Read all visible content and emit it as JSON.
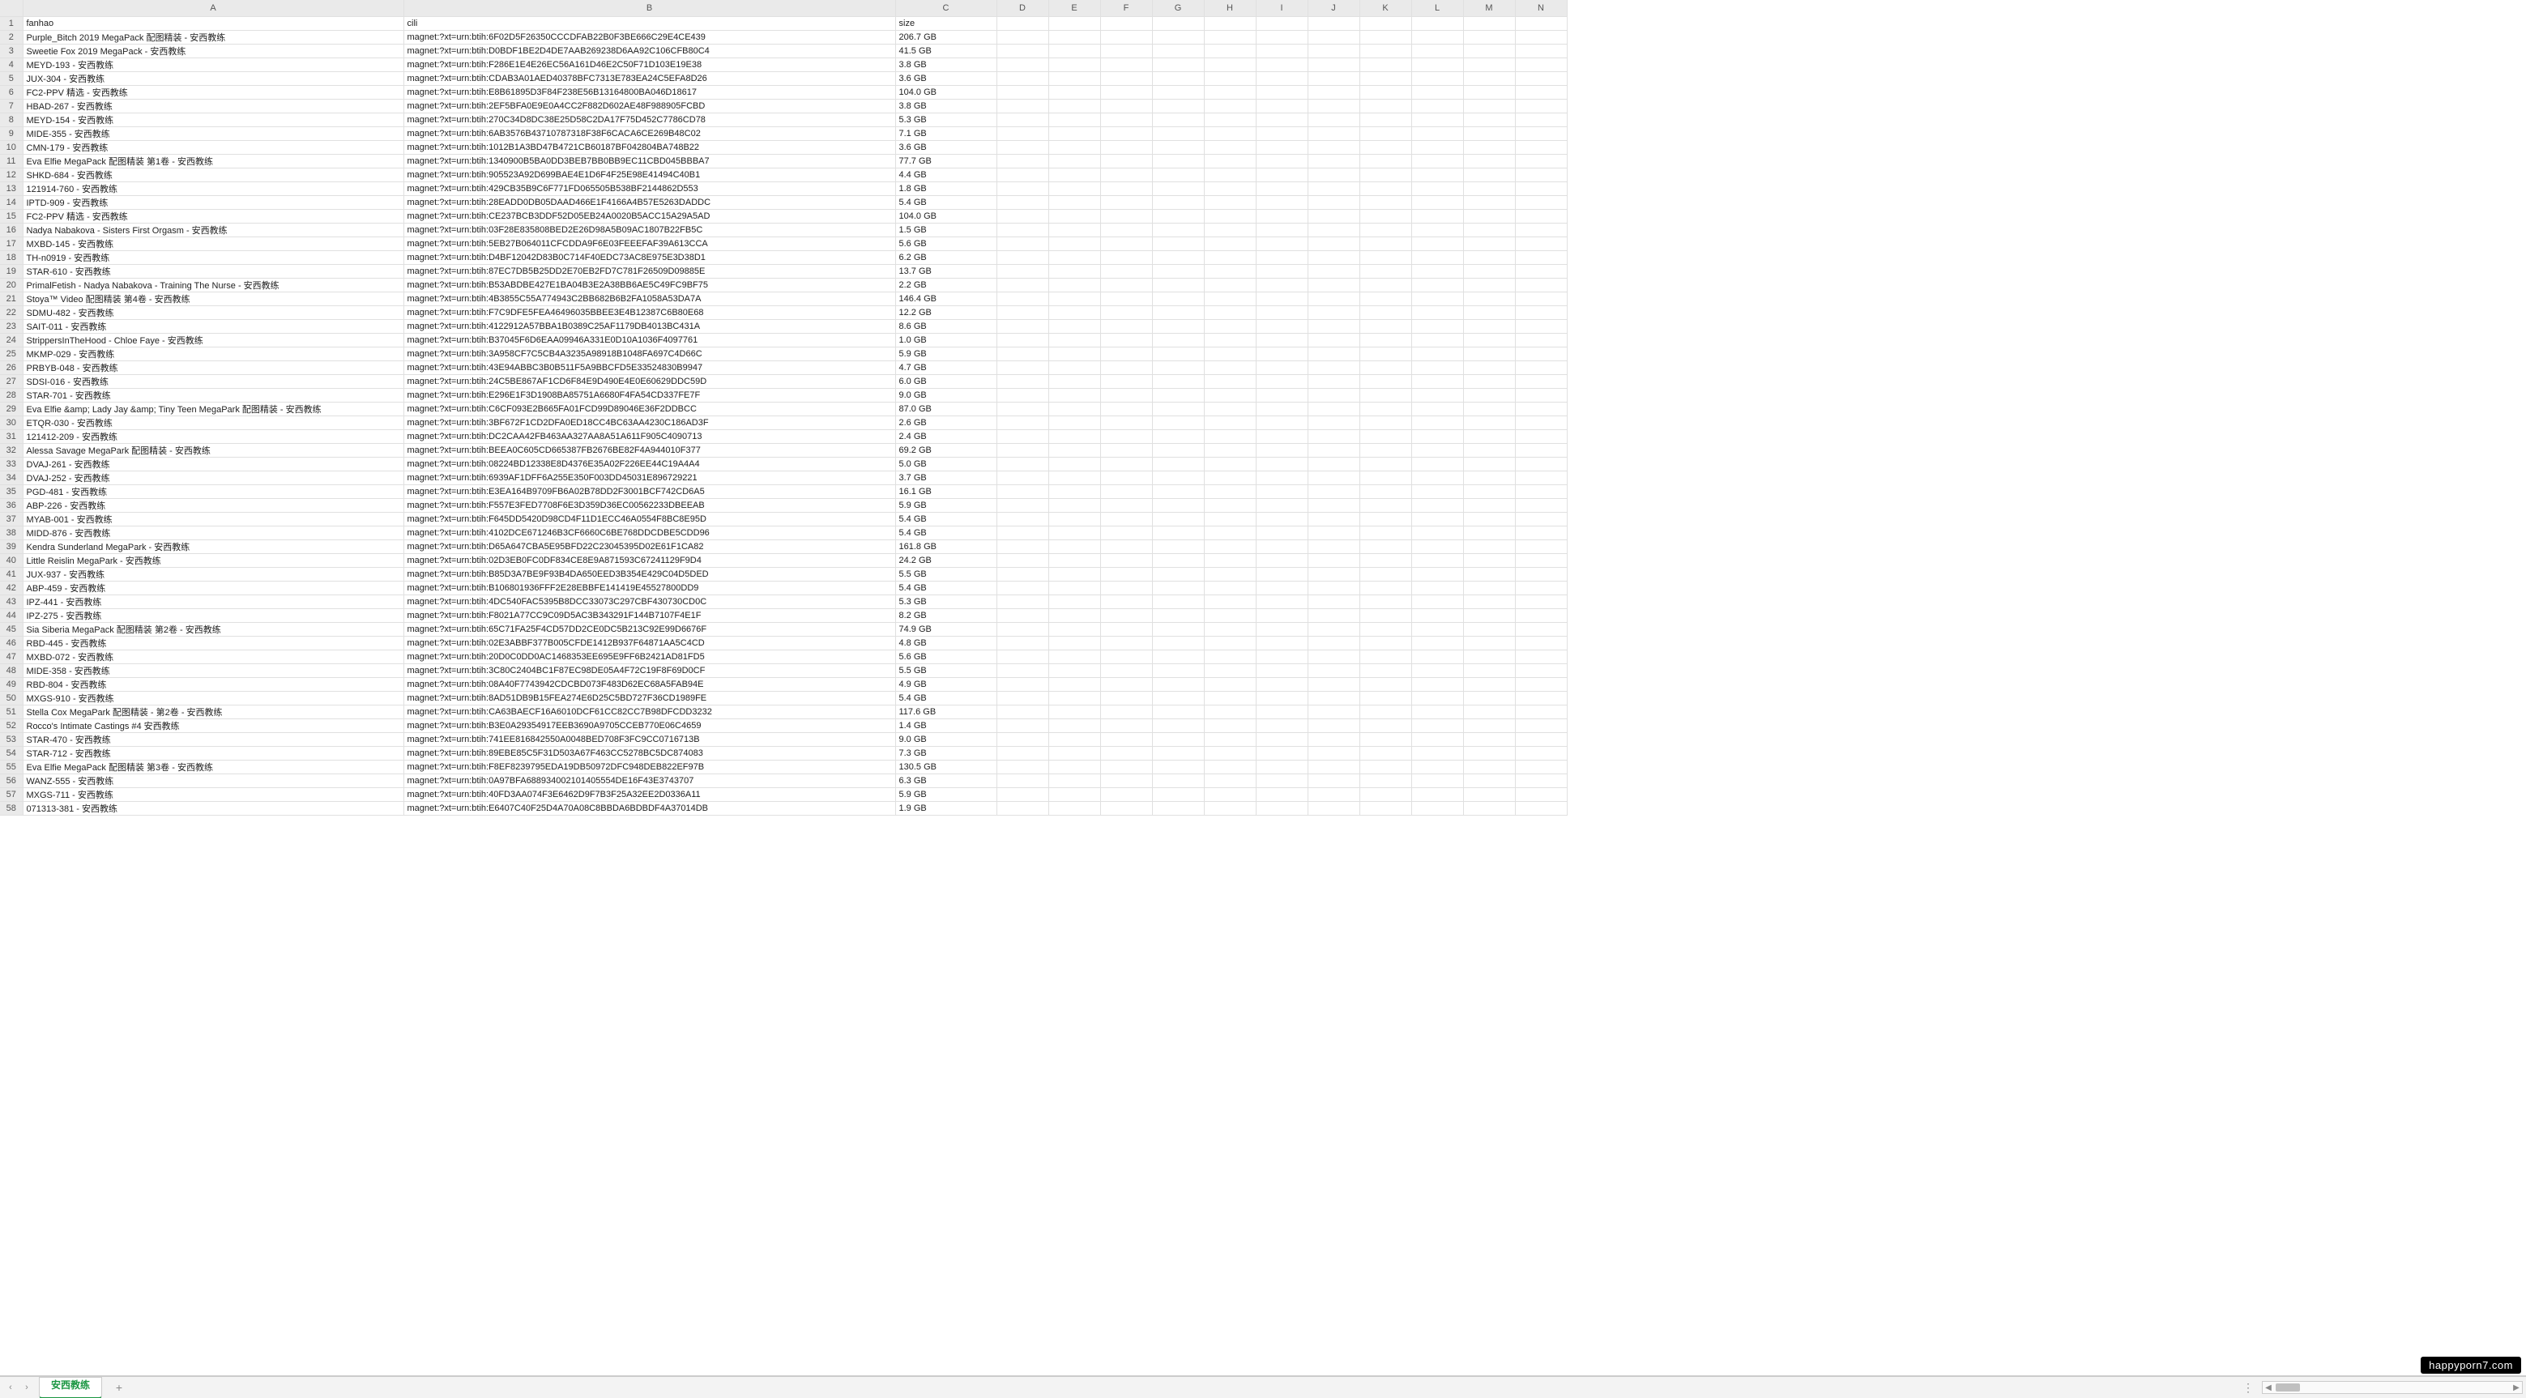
{
  "columns": [
    "A",
    "B",
    "C",
    "D",
    "E",
    "F",
    "G",
    "H",
    "I",
    "J",
    "K",
    "L",
    "M",
    "N"
  ],
  "headers": {
    "A": "fanhao",
    "B": "cili",
    "C": "size"
  },
  "rows": [
    {
      "n": "1",
      "A": "fanhao",
      "B": "cili",
      "C": "size"
    },
    {
      "n": "2",
      "A": "Purple_Bitch 2019 MegaPack 配图精装 - 安西教练",
      "B": "magnet:?xt=urn:btih:6F02D5F26350CCCDFAB22B0F3BE666C29E4CE439",
      "C": "206.7 GB"
    },
    {
      "n": "3",
      "A": "Sweetie Fox 2019 MegaPack - 安西教练",
      "B": "magnet:?xt=urn:btih:D0BDF1BE2D4DE7AAB269238D6AA92C106CFB80C4",
      "C": "41.5 GB"
    },
    {
      "n": "4",
      "A": "MEYD-193 - 安西教练",
      "B": "magnet:?xt=urn:btih:F286E1E4E26EC56A161D46E2C50F71D103E19E38",
      "C": "3.8 GB"
    },
    {
      "n": "5",
      "A": "JUX-304 - 安西教练",
      "B": "magnet:?xt=urn:btih:CDAB3A01AED40378BFC7313E783EA24C5EFA8D26",
      "C": "3.6 GB"
    },
    {
      "n": "6",
      "A": "FC2-PPV 精选 - 安西教练",
      "B": "magnet:?xt=urn:btih:E8B61895D3F84F238E56B13164800BA046D18617",
      "C": "104.0 GB"
    },
    {
      "n": "7",
      "A": "HBAD-267 - 安西教练",
      "B": "magnet:?xt=urn:btih:2EF5BFA0E9E0A4CC2F882D602AE48F988905FCBD",
      "C": "3.8 GB"
    },
    {
      "n": "8",
      "A": "MEYD-154 - 安西教练",
      "B": "magnet:?xt=urn:btih:270C34D8DC38E25D58C2DA17F75D452C7786CD78",
      "C": "5.3 GB"
    },
    {
      "n": "9",
      "A": "MIDE-355 - 安西教练",
      "B": "magnet:?xt=urn:btih:6AB3576B43710787318F38F6CACA6CE269B48C02",
      "C": "7.1 GB"
    },
    {
      "n": "10",
      "A": "CMN-179 - 安西教练",
      "B": "magnet:?xt=urn:btih:1012B1A3BD47B4721CB60187BF042804BA748B22",
      "C": "3.6 GB"
    },
    {
      "n": "11",
      "A": "Eva Elfie MegaPack 配图精装 第1卷 - 安西教练",
      "B": "magnet:?xt=urn:btih:1340900B5BA0DD3BEB7BB0BB9EC11CBD045BBBA7",
      "C": "77.7 GB"
    },
    {
      "n": "12",
      "A": "SHKD-684 - 安西教练",
      "B": "magnet:?xt=urn:btih:905523A92D699BAE4E1D6F4F25E98E41494C40B1",
      "C": "4.4 GB"
    },
    {
      "n": "13",
      "A": "121914-760 - 安西教练",
      "B": "magnet:?xt=urn:btih:429CB35B9C6F771FD065505B538BF2144862D553",
      "C": "1.8 GB"
    },
    {
      "n": "14",
      "A": "IPTD-909 - 安西教练",
      "B": "magnet:?xt=urn:btih:28EADD0DB05DAAD466E1F4166A4B57E5263DADDC",
      "C": "5.4 GB"
    },
    {
      "n": "15",
      "A": "FC2-PPV 精选 - 安西教练",
      "B": "magnet:?xt=urn:btih:CE237BCB3DDF52D05EB24A0020B5ACC15A29A5AD",
      "C": "104.0 GB"
    },
    {
      "n": "16",
      "A": "Nadya Nabakova - Sisters First Orgasm - 安西教练",
      "B": "magnet:?xt=urn:btih:03F28E835808BED2E26D98A5B09AC1807B22FB5C",
      "C": "1.5 GB"
    },
    {
      "n": "17",
      "A": "MXBD-145 - 安西教练",
      "B": "magnet:?xt=urn:btih:5EB27B064011CFCDDA9F6E03FEEEFAF39A613CCA",
      "C": "5.6 GB"
    },
    {
      "n": "18",
      "A": "TH-n0919 - 安西教练",
      "B": "magnet:?xt=urn:btih:D4BF12042D83B0C714F40EDC73AC8E975E3D38D1",
      "C": "6.2 GB"
    },
    {
      "n": "19",
      "A": "STAR-610 - 安西教练",
      "B": "magnet:?xt=urn:btih:87EC7DB5B25DD2E70EB2FD7C781F26509D09885E",
      "C": "13.7 GB"
    },
    {
      "n": "20",
      "A": "PrimalFetish - Nadya Nabakova - Training The Nurse - 安西教练",
      "B": "magnet:?xt=urn:btih:B53ABDBE427E1BA04B3E2A38BB6AE5C49FC9BF75",
      "C": "2.2 GB"
    },
    {
      "n": "21",
      "A": "Stoya™ Video 配图精装 第4卷 - 安西教练",
      "B": "magnet:?xt=urn:btih:4B3855C55A774943C2BB682B6B2FA1058A53DA7A",
      "C": "146.4 GB"
    },
    {
      "n": "22",
      "A": "SDMU-482 - 安西教练",
      "B": "magnet:?xt=urn:btih:F7C9DFE5FEA46496035BBEE3E4B12387C6B80E68",
      "C": "12.2 GB"
    },
    {
      "n": "23",
      "A": "SAIT-011 - 安西教练",
      "B": "magnet:?xt=urn:btih:4122912A57BBA1B0389C25AF1179DB4013BC431A",
      "C": "8.6 GB"
    },
    {
      "n": "24",
      "A": "StrippersInTheHood - Chloe Faye - 安西教练",
      "B": "magnet:?xt=urn:btih:B37045F6D6EAA09946A331E0D10A1036F4097761",
      "C": "1.0 GB"
    },
    {
      "n": "25",
      "A": "MKMP-029 - 安西教练",
      "B": "magnet:?xt=urn:btih:3A958CF7C5CB4A3235A98918B1048FA697C4D66C",
      "C": "5.9 GB"
    },
    {
      "n": "26",
      "A": "PRBYB-048 - 安西教练",
      "B": "magnet:?xt=urn:btih:43E94ABBC3B0B511F5A9BBCFD5E33524830B9947",
      "C": "4.7 GB"
    },
    {
      "n": "27",
      "A": "SDSI-016 - 安西教练",
      "B": "magnet:?xt=urn:btih:24C5BE867AF1CD6F84E9D490E4E0E60629DDC59D",
      "C": "6.0 GB"
    },
    {
      "n": "28",
      "A": "STAR-701 - 安西教练",
      "B": "magnet:?xt=urn:btih:E296E1F3D1908BA85751A6680F4FA54CD337FE7F",
      "C": "9.0 GB"
    },
    {
      "n": "29",
      "A": "Eva Elfie &amp; Lady Jay &amp; Tiny Teen MegaPark 配图精装 - 安西教练",
      "B": "magnet:?xt=urn:btih:C6CF093E2B665FA01FCD99D89046E36F2DDBCC",
      "C": "87.0 GB"
    },
    {
      "n": "30",
      "A": "ETQR-030 - 安西教练",
      "B": "magnet:?xt=urn:btih:3BF672F1CD2DFA0ED18CC4BC63AA4230C186AD3F",
      "C": "2.6 GB"
    },
    {
      "n": "31",
      "A": "121412-209 - 安西教练",
      "B": "magnet:?xt=urn:btih:DC2CAA42FB463AA327AA8A51A611F905C4090713",
      "C": "2.4 GB"
    },
    {
      "n": "32",
      "A": "Alessa Savage MegaPark 配图精装 - 安西教练",
      "B": "magnet:?xt=urn:btih:BEEA0C605CD665387FB2676BE82F4A944010F377",
      "C": "69.2 GB"
    },
    {
      "n": "33",
      "A": "DVAJ-261 - 安西教练",
      "B": "magnet:?xt=urn:btih:08224BD12338E8D4376E35A02F226EE44C19A4A4",
      "C": "5.0 GB"
    },
    {
      "n": "34",
      "A": "DVAJ-252 - 安西教练",
      "B": "magnet:?xt=urn:btih:6939AF1DFF6A255E350F003DD45031E896729221",
      "C": "3.7 GB"
    },
    {
      "n": "35",
      "A": "PGD-481 - 安西教练",
      "B": "magnet:?xt=urn:btih:E3EA164B9709FB6A02B78DD2F3001BCF742CD6A5",
      "C": "16.1 GB"
    },
    {
      "n": "36",
      "A": "ABP-226 - 安西教练",
      "B": "magnet:?xt=urn:btih:F557E3FED7708F6E3D359D36EC00562233DBEEAB",
      "C": "5.9 GB"
    },
    {
      "n": "37",
      "A": "MYAB-001 - 安西教练",
      "B": "magnet:?xt=urn:btih:F645DD5420D98CD4F11D1ECC46A0554F8BC8E95D",
      "C": "5.4 GB"
    },
    {
      "n": "38",
      "A": "MIDD-876 - 安西教练",
      "B": "magnet:?xt=urn:btih:4102DCE671246B3CF6660C6BE768DDCDBE5CDD96",
      "C": "5.4 GB"
    },
    {
      "n": "39",
      "A": "Kendra Sunderland MegaPark - 安西教练",
      "B": "magnet:?xt=urn:btih:D65A647CBA5E95BFD22C23045395D02E61F1CA82",
      "C": "161.8 GB"
    },
    {
      "n": "40",
      "A": "Little Reislin MegaPark - 安西教练",
      "B": "magnet:?xt=urn:btih:02D3EB0FC0DF834CE8E9A871593C67241129F9D4",
      "C": "24.2 GB"
    },
    {
      "n": "41",
      "A": "JUX-937 - 安西教练",
      "B": "magnet:?xt=urn:btih:B85D3A7BE9F93B4DA650EED3B354E429C04D5DED",
      "C": "5.5 GB"
    },
    {
      "n": "42",
      "A": "ABP-459 - 安西教练",
      "B": "magnet:?xt=urn:btih:B106801936FFF2E28EBBFE141419E45527800DD9",
      "C": "5.4 GB"
    },
    {
      "n": "43",
      "A": "IPZ-441 - 安西教练",
      "B": "magnet:?xt=urn:btih:4DC540FAC5395B8DCC33073C297CBF430730CD0C",
      "C": "5.3 GB"
    },
    {
      "n": "44",
      "A": "IPZ-275 - 安西教练",
      "B": "magnet:?xt=urn:btih:F8021A77CC9C09D5AC3B343291F144B7107F4E1F",
      "C": "8.2 GB"
    },
    {
      "n": "45",
      "A": "Sia Siberia MegaPack 配图精装 第2卷 - 安西教练",
      "B": "magnet:?xt=urn:btih:65C71FA25F4CD57DD2CE0DC5B213C92E99D6676F",
      "C": "74.9 GB"
    },
    {
      "n": "46",
      "A": "RBD-445 - 安西教练",
      "B": "magnet:?xt=urn:btih:02E3ABBF377B005CFDE1412B937F64871AA5C4CD",
      "C": "4.8 GB"
    },
    {
      "n": "47",
      "A": "MXBD-072 - 安西教练",
      "B": "magnet:?xt=urn:btih:20D0C0DD0AC1468353EE695E9FF6B2421AD81FD5",
      "C": "5.6 GB"
    },
    {
      "n": "48",
      "A": "MIDE-358 - 安西教练",
      "B": "magnet:?xt=urn:btih:3C80C2404BC1F87EC98DE05A4F72C19F8F69D0CF",
      "C": "5.5 GB"
    },
    {
      "n": "49",
      "A": "RBD-804 - 安西教练",
      "B": "magnet:?xt=urn:btih:08A40F7743942CDCBD073F483D62EC68A5FAB94E",
      "C": "4.9 GB"
    },
    {
      "n": "50",
      "A": "MXGS-910 - 安西教练",
      "B": "magnet:?xt=urn:btih:8AD51DB9B15FEA274E6D25C5BD727F36CD1989FE",
      "C": "5.4 GB"
    },
    {
      "n": "51",
      "A": "Stella Cox MegaPark 配图精装 - 第2卷 - 安西教练",
      "B": "magnet:?xt=urn:btih:CA63BAECF16A6010DCF61CC82CC7B98DFCDD3232",
      "C": "117.6 GB"
    },
    {
      "n": "52",
      "A": "Rocco's Intimate Castings #4 安西教练",
      "B": "magnet:?xt=urn:btih:B3E0A29354917EEB3690A9705CCEB770E06C4659",
      "C": "1.4 GB"
    },
    {
      "n": "53",
      "A": "STAR-470 - 安西教练",
      "B": "magnet:?xt=urn:btih:741EE816842550A0048BED708F3FC9CC0716713B",
      "C": "9.0 GB"
    },
    {
      "n": "54",
      "A": "STAR-712 - 安西教练",
      "B": "magnet:?xt=urn:btih:89EBE85C5F31D503A67F463CC5278BC5DC874083",
      "C": "7.3 GB"
    },
    {
      "n": "55",
      "A": "Eva Elfie MegaPack 配图精装 第3卷 - 安西教练",
      "B": "magnet:?xt=urn:btih:F8EF8239795EDA19DB50972DFC948DEB822EF97B",
      "C": "130.5 GB"
    },
    {
      "n": "56",
      "A": "WANZ-555 - 安西教练",
      "B": "magnet:?xt=urn:btih:0A97BFA688934002101405554DE16F43E3743707",
      "C": "6.3 GB"
    },
    {
      "n": "57",
      "A": "MXGS-711 - 安西教练",
      "B": "magnet:?xt=urn:btih:40FD3AA074F3E6462D9F7B3F25A32EE2D0336A11",
      "C": "5.9 GB"
    },
    {
      "n": "58",
      "A": "071313-381 - 安西教练",
      "B": "magnet:?xt=urn:btih:E6407C40F25D4A70A08C8BBDA6BDBDF4A37014DB",
      "C": "1.9 GB"
    }
  ],
  "footer": {
    "sheet_tab": "安西教练",
    "add_sheet": "+",
    "nav_prev": "‹",
    "nav_next": "›",
    "more": "⋮",
    "scroll_left": "◀",
    "scroll_right": "▶"
  },
  "watermark": "happyporn7.com"
}
